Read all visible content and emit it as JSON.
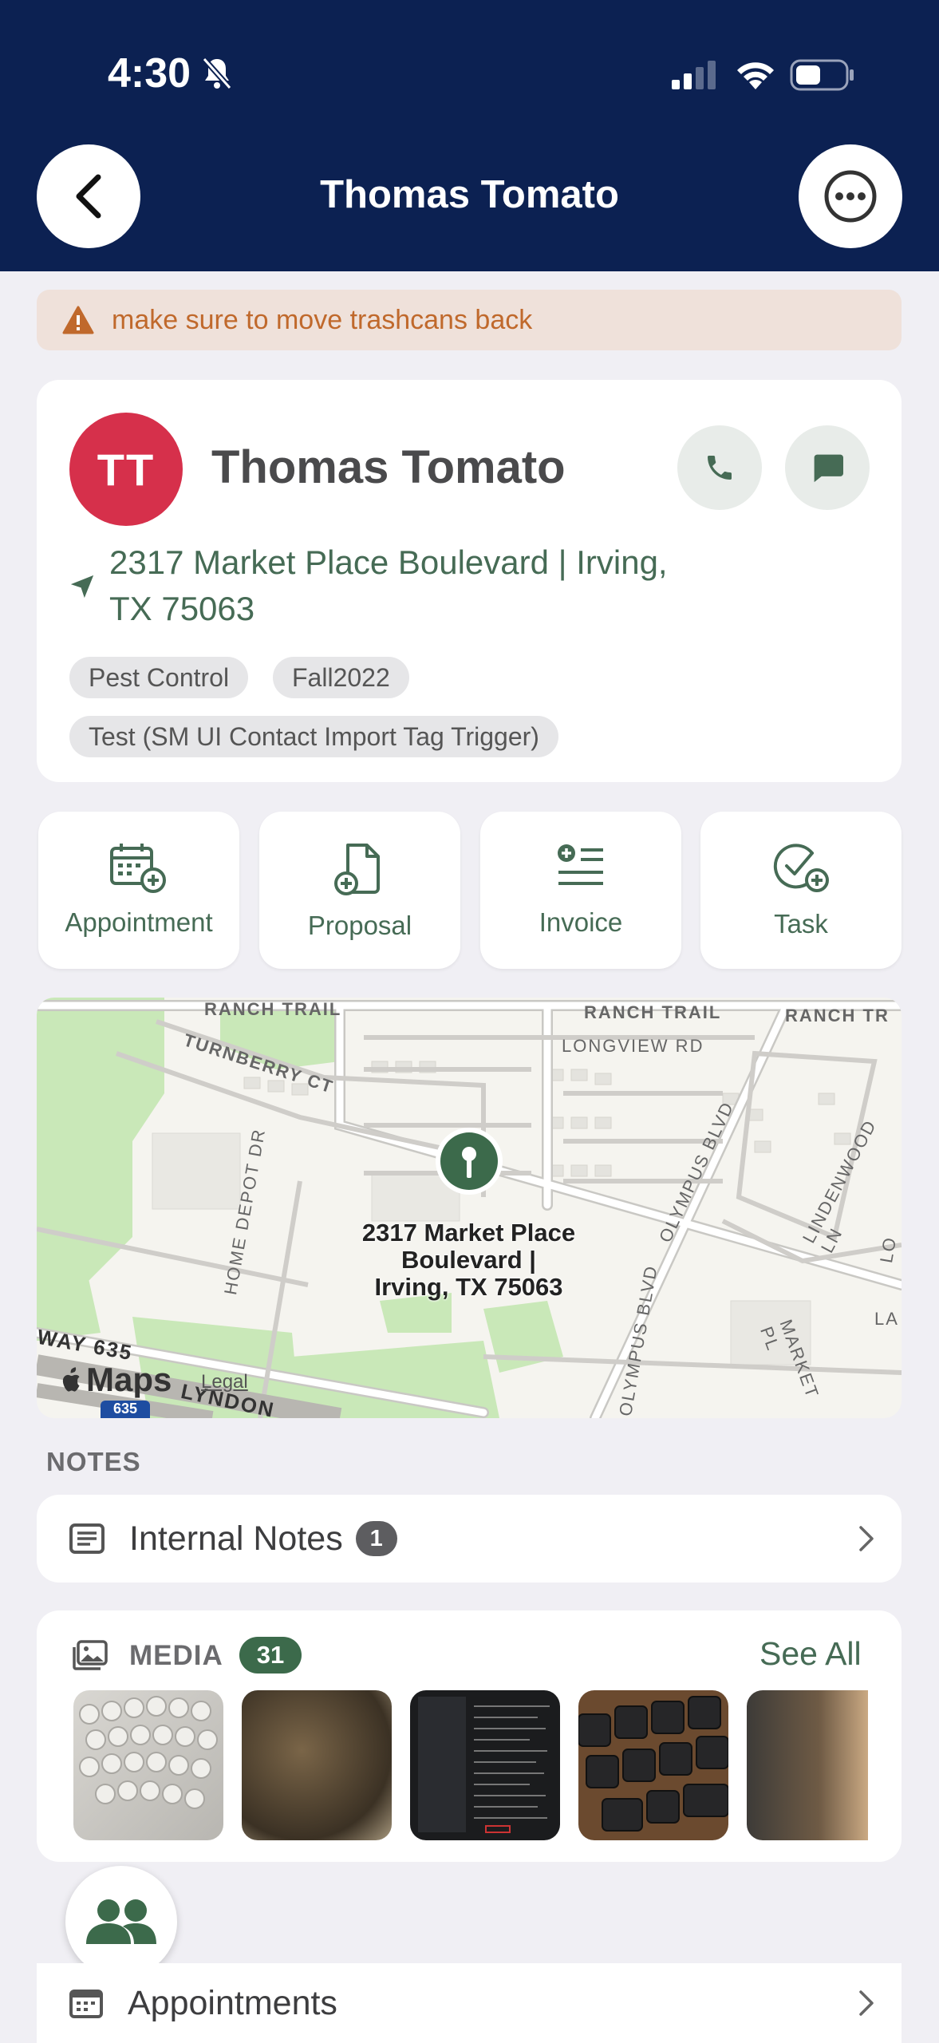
{
  "status_bar": {
    "time": "4:30"
  },
  "header": {
    "title": "Thomas Tomato"
  },
  "alert": {
    "text": "make sure to move trashcans back"
  },
  "contact": {
    "initials": "TT",
    "name": "Thomas Tomato",
    "address_line1": "2317 Market Place Boulevard | Irving,",
    "address_line2": "TX 75063",
    "tags": [
      "Pest Control",
      "Fall2022",
      "Test (SM UI Contact Import Tag Trigger)"
    ]
  },
  "actions": [
    {
      "label": "Appointment",
      "icon": "calendar-add-icon"
    },
    {
      "label": "Proposal",
      "icon": "document-add-icon"
    },
    {
      "label": "Invoice",
      "icon": "invoice-add-icon"
    },
    {
      "label": "Task",
      "icon": "task-check-icon"
    }
  ],
  "map": {
    "pin_label_1": "2317 Market Place",
    "pin_label_2": "Boulevard |",
    "pin_label_3": "Irving, TX 75063",
    "streets": {
      "ranch1": "RANCH TRAIL",
      "ranch2": "RANCH TRAIL",
      "ranch3": "RANCH TR",
      "longview": "LONGVIEW RD",
      "turnberry": "TURNBERRY CT",
      "homedepot": "HOME DEPOT DR",
      "olympus1": "OLYMPUS BLVD",
      "olympus2": "OLYMPUS BLVD",
      "lindenwood": "LINDENWOOD LN",
      "market": "MARKET PL",
      "hwy": "WAY 635",
      "lyndon": "LYNDON",
      "lo": "LO",
      "la": "LA",
      "shield": "635"
    },
    "maps_logo": "Maps",
    "legal": "Legal"
  },
  "notes": {
    "heading": "NOTES",
    "internal_label": "Internal Notes",
    "internal_count": "1"
  },
  "media": {
    "title": "MEDIA",
    "count": "31",
    "see_all": "See All"
  },
  "appointments": {
    "label": "Appointments"
  },
  "colors": {
    "header_bg": "#0c2152",
    "accent_green": "#466b55",
    "avatar_red": "#d6304b",
    "alert_text": "#c0692c"
  }
}
